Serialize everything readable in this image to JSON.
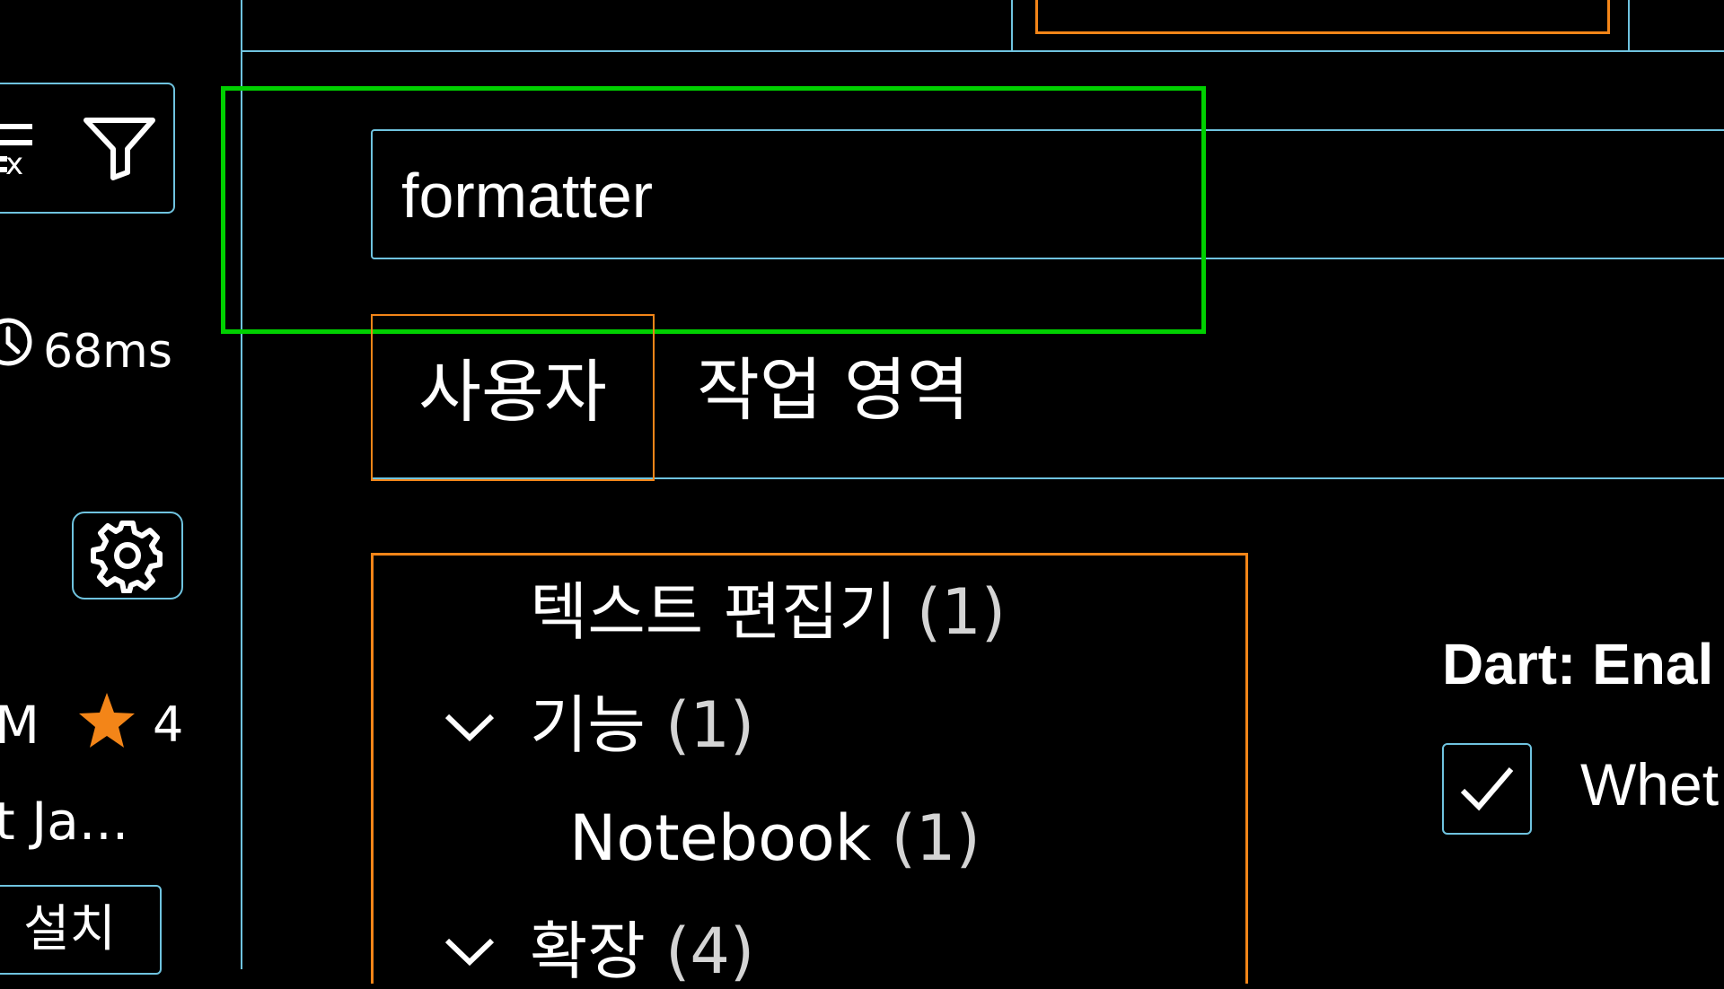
{
  "theme": {
    "border": "#6fc3df",
    "active_border": "#f38518",
    "focus_highlight": "#00d000",
    "star": "#f38518",
    "background": "#000000"
  },
  "sidebar": {
    "toolbar": {
      "clear_icon": "clear-extensions-search-icon",
      "filter_icon": "filter-icon"
    },
    "timing": {
      "icon": "clock-icon",
      "text": "68ms"
    },
    "manage_icon": "gear-icon",
    "extension": {
      "publisher_fragment": "M",
      "rating_icon": "star-icon",
      "rating_count": "4",
      "name_fragment": "t Ja...",
      "install_label": "설치"
    }
  },
  "settings": {
    "search": {
      "value": "formatter"
    },
    "scope_tabs": [
      {
        "label": "사용자",
        "active": true
      },
      {
        "label": "작업 영역",
        "active": false
      }
    ],
    "toc": {
      "text_editor": {
        "label": "텍스트 편집기",
        "count": "(1)"
      },
      "features": {
        "label": "기능",
        "count": "(1)"
      },
      "notebook": {
        "label": "Notebook",
        "count": "(1)"
      },
      "extensions": {
        "label": "확장",
        "count": "(4)"
      }
    },
    "setting": {
      "title": "Dart: Enal",
      "checked": true,
      "description": "Whet"
    }
  }
}
